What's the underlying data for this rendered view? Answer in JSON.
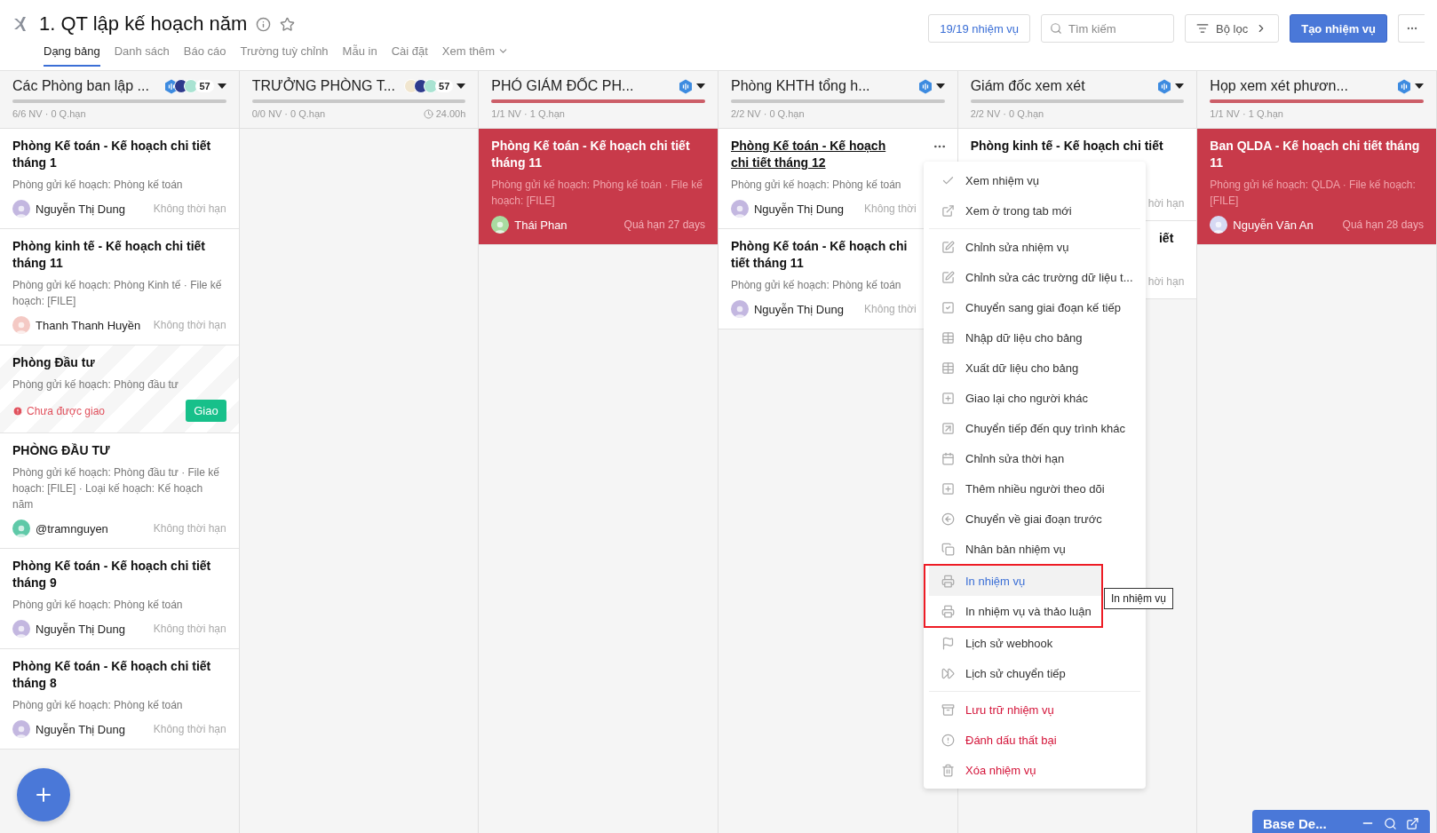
{
  "header": {
    "title": "1. QT lập kế hoạch năm",
    "starred": false,
    "tabs": [
      {
        "label": "Dạng bảng",
        "selected": true
      },
      {
        "label": "Danh sách",
        "selected": false
      },
      {
        "label": "Báo cáo",
        "selected": false
      },
      {
        "label": "Trường tuỳ chỉnh",
        "selected": false
      },
      {
        "label": "Mẫu in",
        "selected": false
      },
      {
        "label": "Cài đặt",
        "selected": false
      },
      {
        "label": "Xem thêm",
        "selected": false
      }
    ],
    "task_count": "19/19 nhiệm vụ",
    "search": {
      "placeholder": "Tìm kiếm"
    },
    "filter": "Bộ lọc",
    "create": "Tạo nhiệm vụ"
  },
  "columns": [
    {
      "title": "Các Phòng ban lập ...",
      "overdue": false,
      "stats": "6/6 NV · 0 Q.hạn",
      "members": "57",
      "avatars": [
        {
          "kind": "hex",
          "color": "#3d8be0"
        },
        {
          "kind": "circle",
          "color": "#2d3a8c"
        },
        {
          "kind": "circle",
          "color": "#a9e3d2"
        }
      ],
      "cards": [
        {
          "kind": "task",
          "title": "Phòng Kế toán - Kế hoạch chi tiết tháng 1",
          "subtitle": "Phòng gửi kế hoạch: Phòng kế toán",
          "assignee": "Nguyễn Thị Dung",
          "color": "#c3b7e0",
          "due": "Không thời hạn",
          "overdue": false,
          "hovered": false
        },
        {
          "kind": "task",
          "title": "Phòng kinh tế - Kế hoạch chi tiết tháng 11",
          "subtitle": "Phòng gửi kế hoạch: Phòng Kinh tế · File kế hoạch: [FILE]",
          "assignee": "Thanh Thanh Huyền",
          "color": "#f4c9c4",
          "due": "Không thời hạn",
          "overdue": false,
          "hovered": false
        },
        {
          "kind": "unassigned",
          "title": "Phòng Đầu tư",
          "subtitle": "Phòng gửi kế hoạch: Phòng đầu tư",
          "warning": "Chưa được giao",
          "action": "Giao"
        },
        {
          "kind": "task",
          "title": "PHÒNG ĐẦU TƯ",
          "subtitle": "Phòng gửi kế hoạch: Phòng đầu tư · File kế hoạch: [FILE] · Loại kế hoạch: Kế hoạch năm",
          "assignee": "@tramnguyen",
          "color": "#5fc9a8",
          "due": "Không thời hạn",
          "overdue": false,
          "hovered": false
        },
        {
          "kind": "task",
          "title": "Phòng Kế toán - Kế hoạch chi tiết tháng 9",
          "subtitle": "Phòng gửi kế hoạch: Phòng kế toán",
          "assignee": "Nguyễn Thị Dung",
          "color": "#c3b7e0",
          "due": "Không thời hạn",
          "overdue": false,
          "hovered": false
        },
        {
          "kind": "task",
          "title": "Phòng Kế toán - Kế hoạch chi tiết tháng 8",
          "subtitle": "Phòng gửi kế hoạch: Phòng kế toán",
          "assignee": "Nguyễn Thị Dung",
          "color": "#c3b7e0",
          "due": "Không thời hạn",
          "overdue": false,
          "hovered": false
        }
      ]
    },
    {
      "title": "TRƯỞNG PHÒNG T...",
      "overdue": false,
      "stats": "0/0 NV · 0 Q.hạn",
      "timer": "24.00h",
      "members": "57",
      "avatars": [
        {
          "kind": "circle",
          "color": "#f1e6cf"
        },
        {
          "kind": "circle",
          "color": "#2d3a8c"
        },
        {
          "kind": "circle",
          "color": "#a9e3d2"
        }
      ]
    },
    {
      "title": "PHÓ GIÁM ĐỐC PH...",
      "overdue": true,
      "stats": "1/1 NV · 1 Q.hạn",
      "avatars": [
        {
          "kind": "hex",
          "color": "#3d8be0"
        }
      ],
      "cards": [
        {
          "kind": "task",
          "title": "Phòng Kế toán - Kế hoạch chi tiết tháng 11",
          "subtitle": "Phòng gửi kế hoạch: Phòng kế toán · File kế hoạch: [FILE]",
          "assignee": "Thái Phan",
          "color": "#a9dba0",
          "due": "Quá hạn 27 days",
          "overdue": true,
          "hovered": false
        }
      ]
    },
    {
      "title": "Phòng KHTH tổng h...",
      "overdue": false,
      "stats": "2/2 NV · 0 Q.hạn",
      "avatars": [
        {
          "kind": "hex",
          "color": "#3d8be0"
        }
      ],
      "cards": [
        {
          "kind": "task",
          "title": "Phòng Kế toán - Kế hoạch chi tiết tháng 12",
          "subtitle": "Phòng gửi kế hoạch: Phòng kế toán",
          "assignee": "Nguyễn Thị Dung",
          "color": "#c3b7e0",
          "due": "Không thời",
          "overdue": false,
          "hovered": true
        },
        {
          "kind": "task",
          "title": "Phòng Kế toán - Kế hoạch chi tiết tháng 11",
          "subtitle": "Phòng gửi kế hoạch: Phòng kế toán",
          "assignee": "Nguyễn Thị Dung",
          "color": "#c3b7e0",
          "due": "Không thời",
          "overdue": false,
          "hovered": false
        }
      ]
    },
    {
      "title": "Giám đốc xem xét",
      "overdue": false,
      "stats": "2/2 NV · 0 Q.hạn",
      "avatars": [
        {
          "kind": "hex",
          "color": "#3d8be0"
        }
      ],
      "cards": [
        {
          "kind": "covered",
          "title": "Phòng kinh tế - Kế hoạch chi tiết",
          "due": "hời hạn"
        },
        {
          "kind": "covered",
          "fragment": "iết",
          "due": "hời hạn"
        }
      ]
    },
    {
      "title": "Họp xem xét phươn...",
      "overdue": true,
      "stats": "1/1 NV · 1 Q.hạn",
      "avatars": [
        {
          "kind": "hex",
          "color": "#3d8be0"
        }
      ],
      "cards": [
        {
          "kind": "task",
          "title": "Ban QLDA - Kế hoạch chi tiết tháng 11",
          "subtitle": "Phòng gửi kế hoạch: QLDA · File kế hoạch: [FILE]",
          "assignee": "Nguyễn Văn An",
          "color": "#d6d9f3",
          "due": "Quá hạn 28 days",
          "overdue": true,
          "hovered": false
        }
      ]
    }
  ],
  "menu": {
    "tooltip": "In nhiệm vụ",
    "sections": [
      {
        "items": [
          {
            "label": "Xem nhiệm vụ",
            "danger": false,
            "hovered": false,
            "boxed": false
          },
          {
            "label": "Xem ở trong tab mới",
            "danger": false,
            "hovered": false,
            "boxed": false
          }
        ]
      },
      {
        "items": [
          {
            "label": "Chỉnh sửa nhiệm vụ",
            "danger": false,
            "hovered": false,
            "boxed": false
          },
          {
            "label": "Chỉnh sửa các trường dữ liệu t...",
            "danger": false,
            "hovered": false,
            "boxed": false
          },
          {
            "label": "Chuyển sang giai đoạn kế tiếp",
            "danger": false,
            "hovered": false,
            "boxed": false
          },
          {
            "label": "Nhập dữ liệu cho bảng",
            "danger": false,
            "hovered": false,
            "boxed": false
          },
          {
            "label": "Xuất dữ liệu cho bảng",
            "danger": false,
            "hovered": false,
            "boxed": false
          },
          {
            "label": "Giao lại cho người khác",
            "danger": false,
            "hovered": false,
            "boxed": false
          },
          {
            "label": "Chuyển tiếp đến quy trình khác",
            "danger": false,
            "hovered": false,
            "boxed": false
          },
          {
            "label": "Chỉnh sửa thời hạn",
            "danger": false,
            "hovered": false,
            "boxed": false
          },
          {
            "label": "Thêm nhiều người theo dõi",
            "danger": false,
            "hovered": false,
            "boxed": false
          },
          {
            "label": "Chuyển về giai đoạn trước",
            "danger": false,
            "hovered": false,
            "boxed": false
          },
          {
            "label": "Nhân bản nhiệm vụ",
            "danger": false,
            "hovered": false,
            "boxed": false
          },
          {
            "label": "In nhiệm vụ",
            "danger": false,
            "hovered": true,
            "boxed": true
          },
          {
            "label": "In nhiệm vụ và thảo luận",
            "danger": false,
            "hovered": false,
            "boxed": true
          },
          {
            "label": "Lịch sử webhook",
            "danger": false,
            "hovered": false,
            "boxed": false
          },
          {
            "label": "Lịch sử chuyển tiếp",
            "danger": false,
            "hovered": false,
            "boxed": false
          }
        ]
      },
      {
        "items": [
          {
            "label": "Lưu trữ nhiệm vụ",
            "danger": true,
            "hovered": false,
            "boxed": false
          },
          {
            "label": "Đánh dấu thất bại",
            "danger": true,
            "hovered": false,
            "boxed": false
          },
          {
            "label": "Xóa nhiệm vụ",
            "danger": true,
            "hovered": false,
            "boxed": false
          }
        ]
      }
    ]
  },
  "chat_widget": {
    "title": "Base De..."
  }
}
